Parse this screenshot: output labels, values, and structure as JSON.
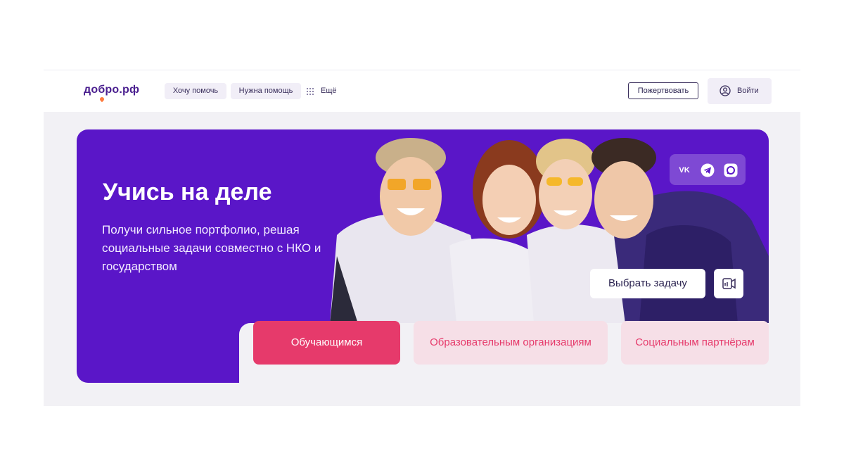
{
  "header": {
    "logo": "добро.рф",
    "nav": [
      "Хочу помочь",
      "Нужна помощь"
    ],
    "more_label": "Ещё",
    "donate_label": "Пожертвовать",
    "login_label": "Войти"
  },
  "hero": {
    "title": "Учись на деле",
    "subtitle": "Получи сильное портфолио, решая социальные задачи совместно с НКО и государством",
    "socials": [
      {
        "icon": "vk-icon",
        "text": "VK"
      },
      {
        "icon": "telegram-icon"
      },
      {
        "icon": "max-messenger-icon"
      }
    ],
    "choose_task_label": "Выбрать задачу",
    "video_icon": "video-icon"
  },
  "tabs": [
    {
      "label": "Обучающимся",
      "active": true
    },
    {
      "label": "Образовательным организациям",
      "active": false
    },
    {
      "label": "Социальным партнёрам",
      "active": false
    }
  ],
  "colors": {
    "brand_purple": "#5a16c8",
    "active_tab": "#e63a6b",
    "inactive_tab_bg": "#f6dfe7",
    "inactive_tab_text": "#e63a6b",
    "logo": "#4a1f8f"
  }
}
